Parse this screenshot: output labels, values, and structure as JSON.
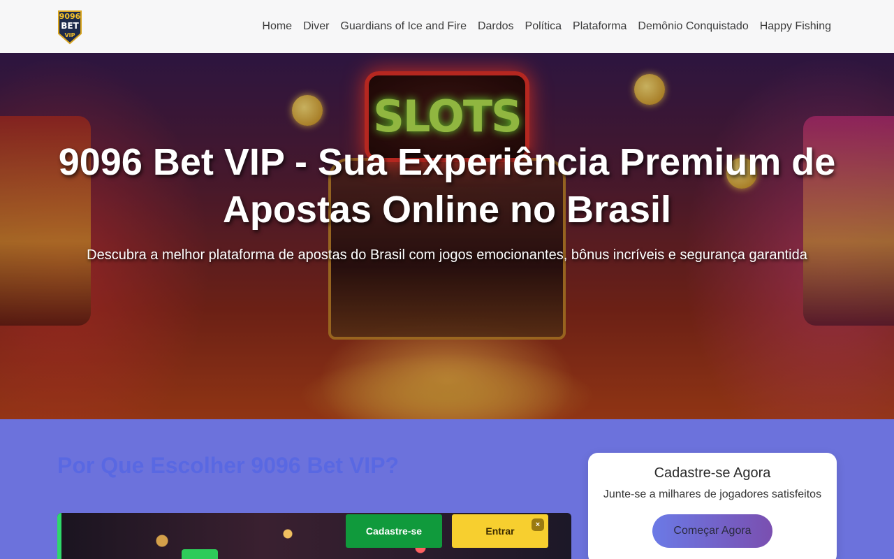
{
  "brand": {
    "logo_line1": "9096",
    "logo_line2": "BET",
    "logo_line3": "VIP"
  },
  "nav": {
    "items": [
      {
        "label": "Home"
      },
      {
        "label": "Diver"
      },
      {
        "label": "Guardians of Ice and Fire"
      },
      {
        "label": "Dardos"
      },
      {
        "label": "Política"
      },
      {
        "label": "Plataforma"
      },
      {
        "label": "Demônio Conquistado"
      },
      {
        "label": "Happy Fishing"
      }
    ]
  },
  "hero": {
    "sign_text": "SLOTS",
    "title": "9096 Bet VIP - Sua Experiência Premium de Apostas Online no Brasil",
    "subtitle": "Descubra a melhor plataforma de apostas do Brasil com jogos emocionantes, bônus incríveis e segurança garantida"
  },
  "why": {
    "title": "Por Que Escolher 9096 Bet VIP?"
  },
  "floating_bar": {
    "register_label": "Cadastre-se",
    "login_label": "Entrar",
    "close_label": "×"
  },
  "signup_card": {
    "title": "Cadastre-se Agora",
    "text": "Junte-se a milhares de jogadores satisfeitos",
    "button_label": "Começar Agora"
  },
  "colors": {
    "section_bg": "#6c72dc",
    "register_button": "#109a3c",
    "login_button": "#f7cf2f",
    "cta_gradient_start": "#6b7ae6",
    "cta_gradient_end": "#7a4fb0"
  }
}
